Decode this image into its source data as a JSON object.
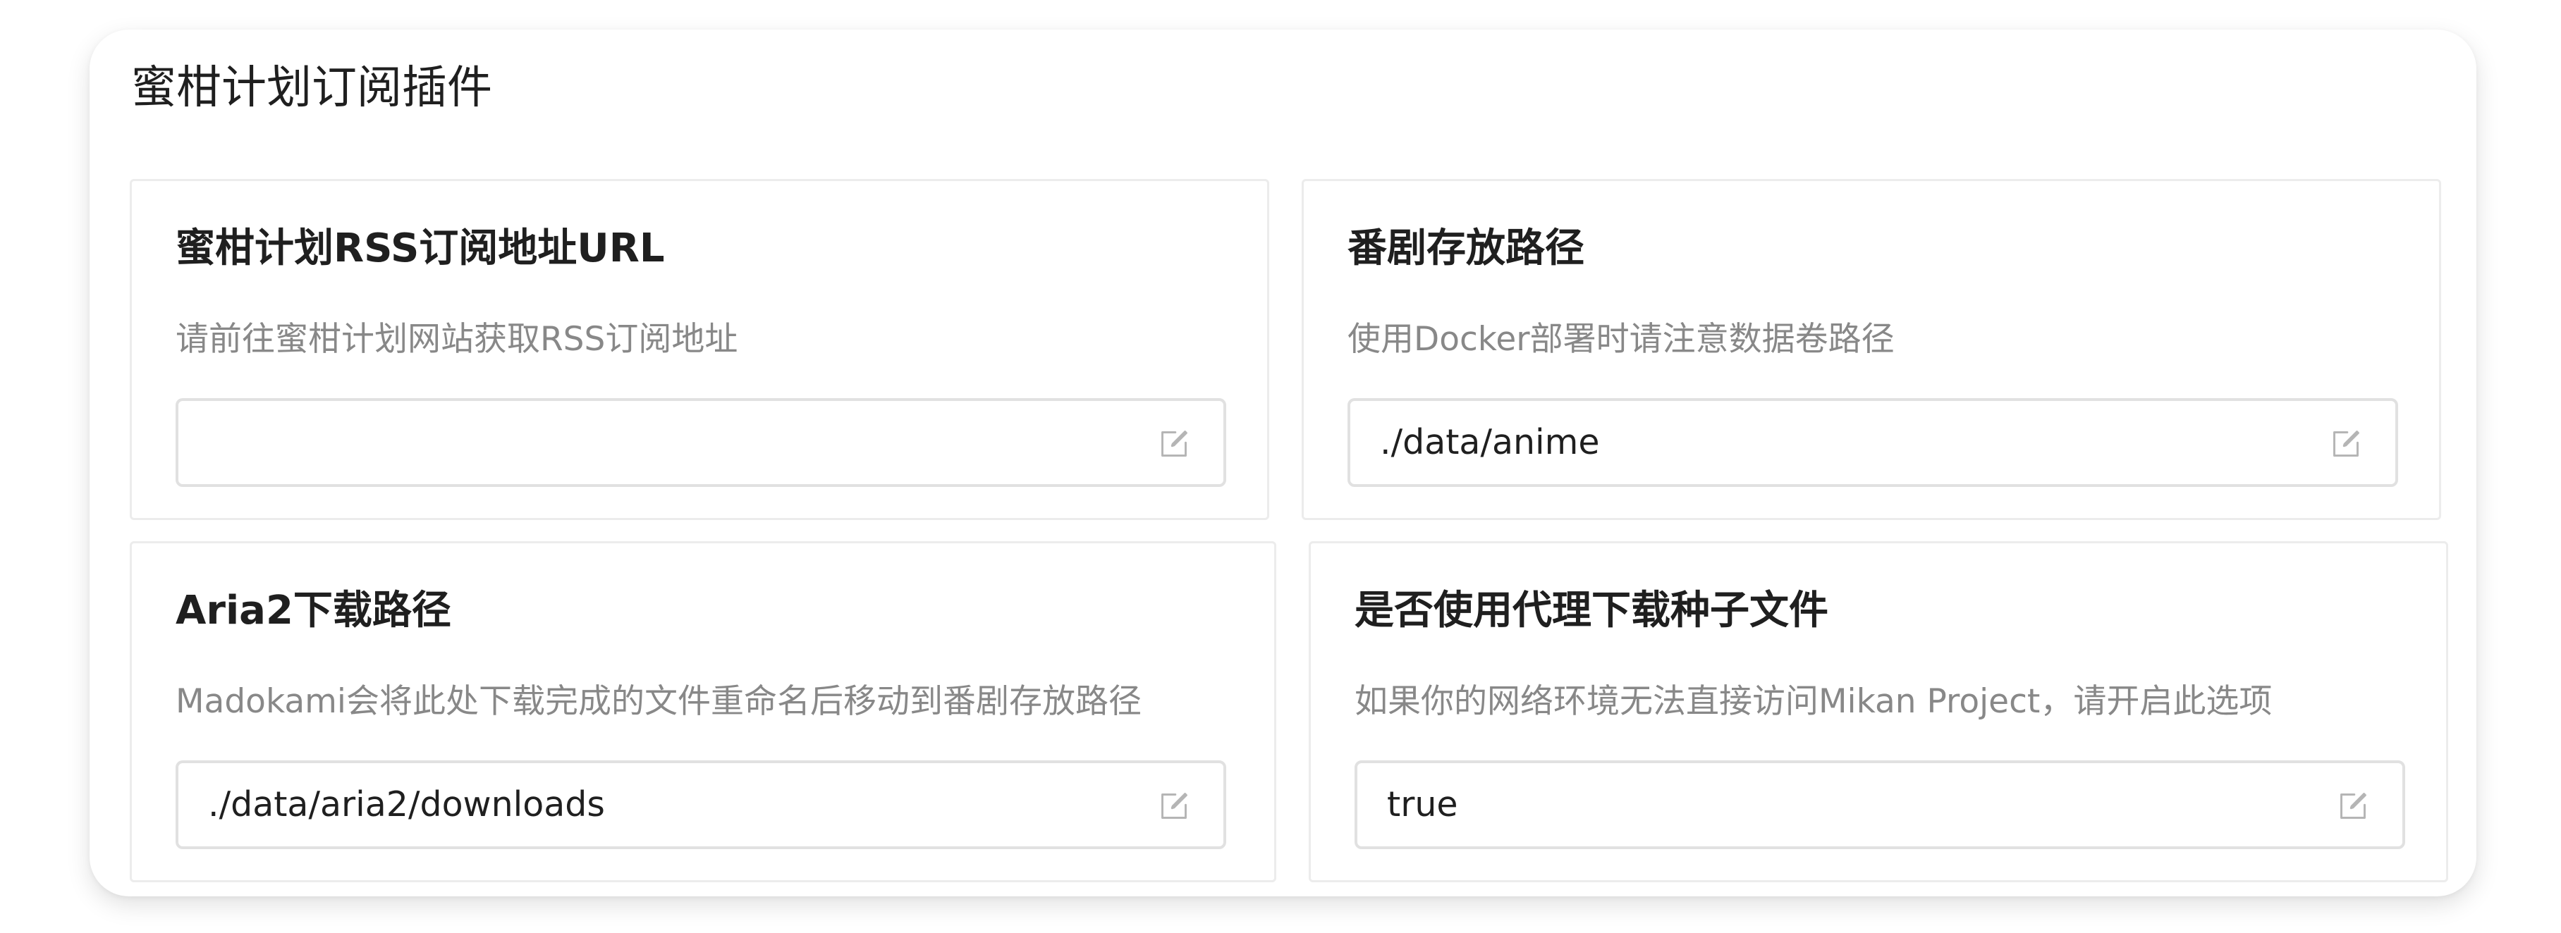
{
  "panel": {
    "title": "蜜柑计划订阅插件"
  },
  "cards": [
    {
      "title": "蜜柑计划RSS订阅地址URL",
      "description": "请前往蜜柑计划网站获取RSS订阅地址",
      "value": "",
      "icon": "edit-icon"
    },
    {
      "title": "番剧存放路径",
      "description": "使用Docker部署时请注意数据卷路径",
      "value": "./data/anime",
      "icon": "edit-icon"
    },
    {
      "title": "Aria2下载路径",
      "description": "Madokami会将此处下载完成的文件重命名后移动到番剧存放路径",
      "value": "./data/aria2/downloads",
      "icon": "edit-icon"
    },
    {
      "title": "是否使用代理下载种子文件",
      "description": "如果你的网络环境无法直接访问Mikan Project，请开启此选项",
      "value": "true",
      "icon": "edit-icon"
    }
  ]
}
